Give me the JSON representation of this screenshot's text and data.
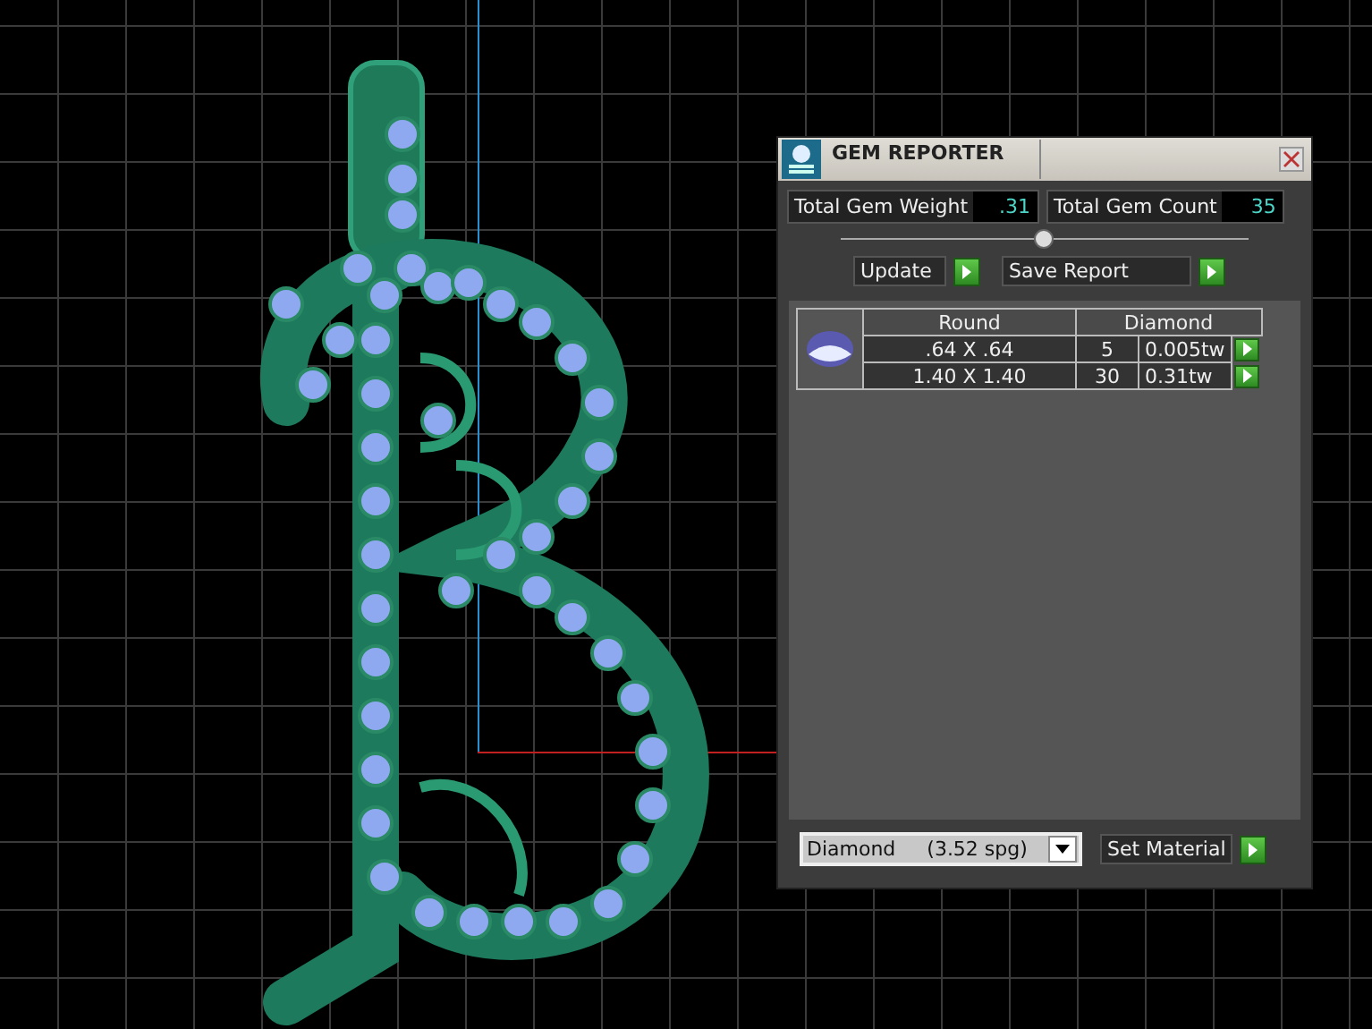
{
  "window": {
    "title": "GEM REPORTER"
  },
  "totals": [
    {
      "label": "Total Gem Weight",
      "value": ".31"
    },
    {
      "label": "Total Gem Count",
      "value": "35"
    }
  ],
  "buttons": [
    {
      "label": "Update"
    },
    {
      "label": "Save Report"
    }
  ],
  "table": {
    "columns": [
      "Round",
      "Diamond"
    ],
    "rows": [
      {
        "size": ".64 X .64",
        "count": "5",
        "weight": "0.005tw"
      },
      {
        "size": "1.40 X 1.40",
        "count": "30",
        "weight": "0.31tw"
      }
    ]
  },
  "material": {
    "value": "Diamond     (3.52 spg)"
  },
  "set_material": {
    "label": "Set Material"
  }
}
